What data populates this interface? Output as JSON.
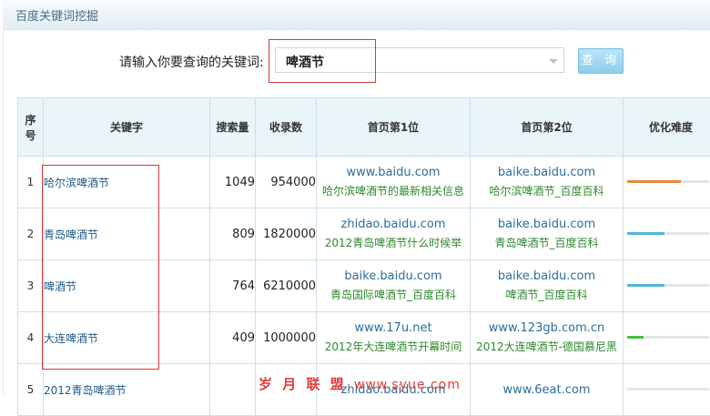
{
  "panel": {
    "title": "百度关键词挖掘"
  },
  "search": {
    "label": "请输入你要查询的关键词:",
    "value": "啤酒节",
    "button_label": "查 询"
  },
  "table": {
    "headers": {
      "index_l1": "序",
      "index_l2": "号",
      "keyword": "关键字",
      "search_volume": "搜索量",
      "indexed": "收录数",
      "rank1": "首页第1位",
      "rank2": "首页第2位",
      "difficulty": "优化难度"
    },
    "rows": [
      {
        "index": "1",
        "keyword": "哈尔滨啤酒节",
        "volume": "1049",
        "indexed": "954000",
        "rank1_domain": "www.baidu.com",
        "rank1_title": "哈尔滨啤酒节的最新相关信息",
        "rank2_domain": "baike.baidu.com",
        "rank2_title": "哈尔滨啤酒节_百度百科",
        "difficulty": 0.65,
        "difficulty_color": "#e8893a"
      },
      {
        "index": "2",
        "keyword": "青岛啤酒节",
        "volume": "809",
        "indexed": "1820000",
        "rank1_domain": "zhidao.baidu.com",
        "rank1_title": "2012青岛啤酒节什么时候举",
        "rank2_domain": "baike.baidu.com",
        "rank2_title": "青岛啤酒节_百度百科",
        "difficulty": 0.45,
        "difficulty_color": "#4fb6d8"
      },
      {
        "index": "3",
        "keyword": "啤酒节",
        "volume": "764",
        "indexed": "6210000",
        "rank1_domain": "baike.baidu.com",
        "rank1_title": "青岛国际啤酒节_百度百科",
        "rank2_domain": "baike.baidu.com",
        "rank2_title": "啤酒节_百度百科",
        "difficulty": 0.45,
        "difficulty_color": "#4fb6d8"
      },
      {
        "index": "4",
        "keyword": "大连啤酒节",
        "volume": "409",
        "indexed": "1000000",
        "rank1_domain": "www.17u.net",
        "rank1_title": "2012年大连啤酒节开幕时间",
        "rank2_domain": "www.123gb.com.cn",
        "rank2_title": "2012大连啤酒节-德国慕尼黑",
        "difficulty": 0.2,
        "difficulty_color": "#44c244"
      },
      {
        "index": "5",
        "keyword": "2012青岛啤酒节",
        "volume": "",
        "indexed": "",
        "rank1_domain": "zhidao.baidu.com",
        "rank1_title": "",
        "rank2_domain": "www.6eat.com",
        "rank2_title": "",
        "difficulty": 0,
        "difficulty_color": "#4fb6d8"
      }
    ]
  },
  "watermark": {
    "text": "岁 月 联 盟",
    "url": "www.syue.com"
  }
}
